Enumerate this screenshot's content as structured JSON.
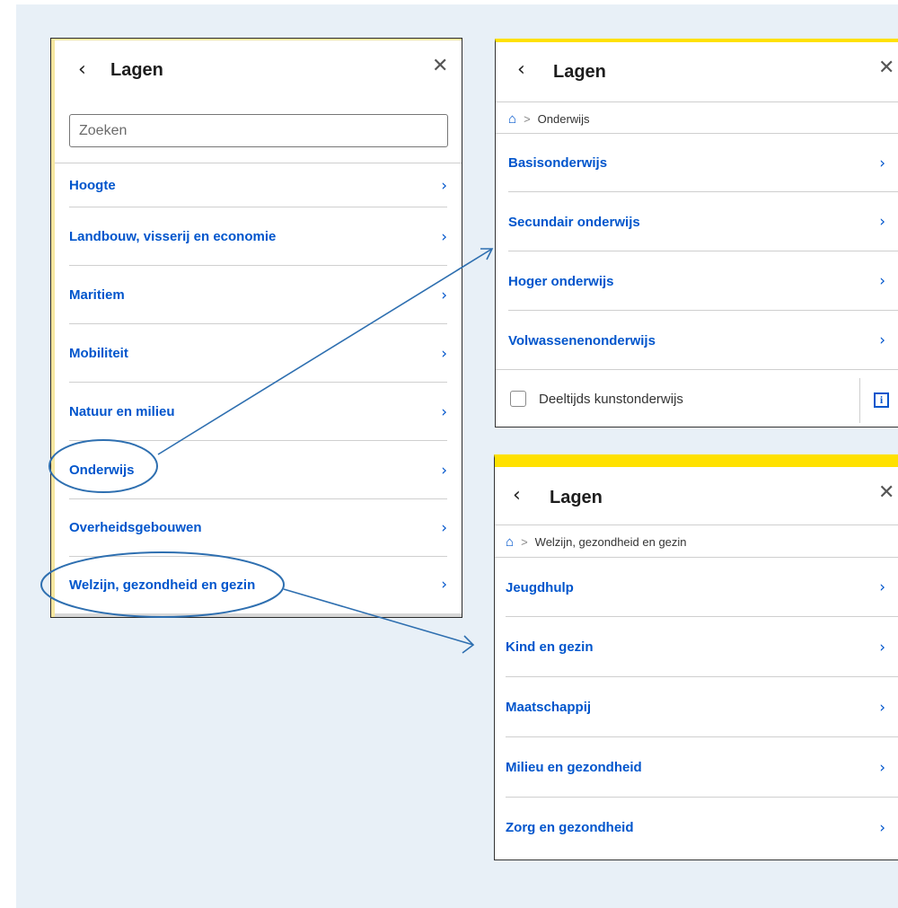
{
  "left_panel": {
    "title": "Lagen",
    "back_icon": "‹",
    "close_icon": "✕",
    "search_placeholder": "Zoeken",
    "items": [
      {
        "label": "Hoogte"
      },
      {
        "label": "Landbouw, visserij en economie"
      },
      {
        "label": "Maritiem"
      },
      {
        "label": "Mobiliteit"
      },
      {
        "label": "Natuur en milieu"
      },
      {
        "label": "Onderwijs"
      },
      {
        "label": "Overheidsgebouwen"
      },
      {
        "label": "Welzijn, gezondheid en gezin"
      }
    ]
  },
  "onderwijs_panel": {
    "title": "Lagen",
    "breadcrumb": "Onderwijs",
    "items": [
      {
        "label": "Basisonderwijs"
      },
      {
        "label": "Secundair onderwijs"
      },
      {
        "label": "Hoger onderwijs"
      },
      {
        "label": "Volwassenenonderwijs"
      }
    ],
    "checkbox_label": "Deeltijds kunstonderwijs",
    "checkbox_checked": false,
    "info_icon": "i"
  },
  "welzijn_panel": {
    "title": "Lagen",
    "breadcrumb": "Welzijn, gezondheid en gezin",
    "items": [
      {
        "label": "Jeugdhulp"
      },
      {
        "label": "Kind en gezin"
      },
      {
        "label": "Maatschappij"
      },
      {
        "label": "Milieu en gezondheid"
      },
      {
        "label": "Zorg en gezondheid"
      }
    ]
  },
  "icons": {
    "chevron": "›",
    "home": "⌂",
    "separator": ">"
  },
  "colors": {
    "link_blue": "#0055cc",
    "accent_yellow": "#ffe100",
    "annotation_blue": "#2e6fb0",
    "background": "#e8f0f7"
  }
}
